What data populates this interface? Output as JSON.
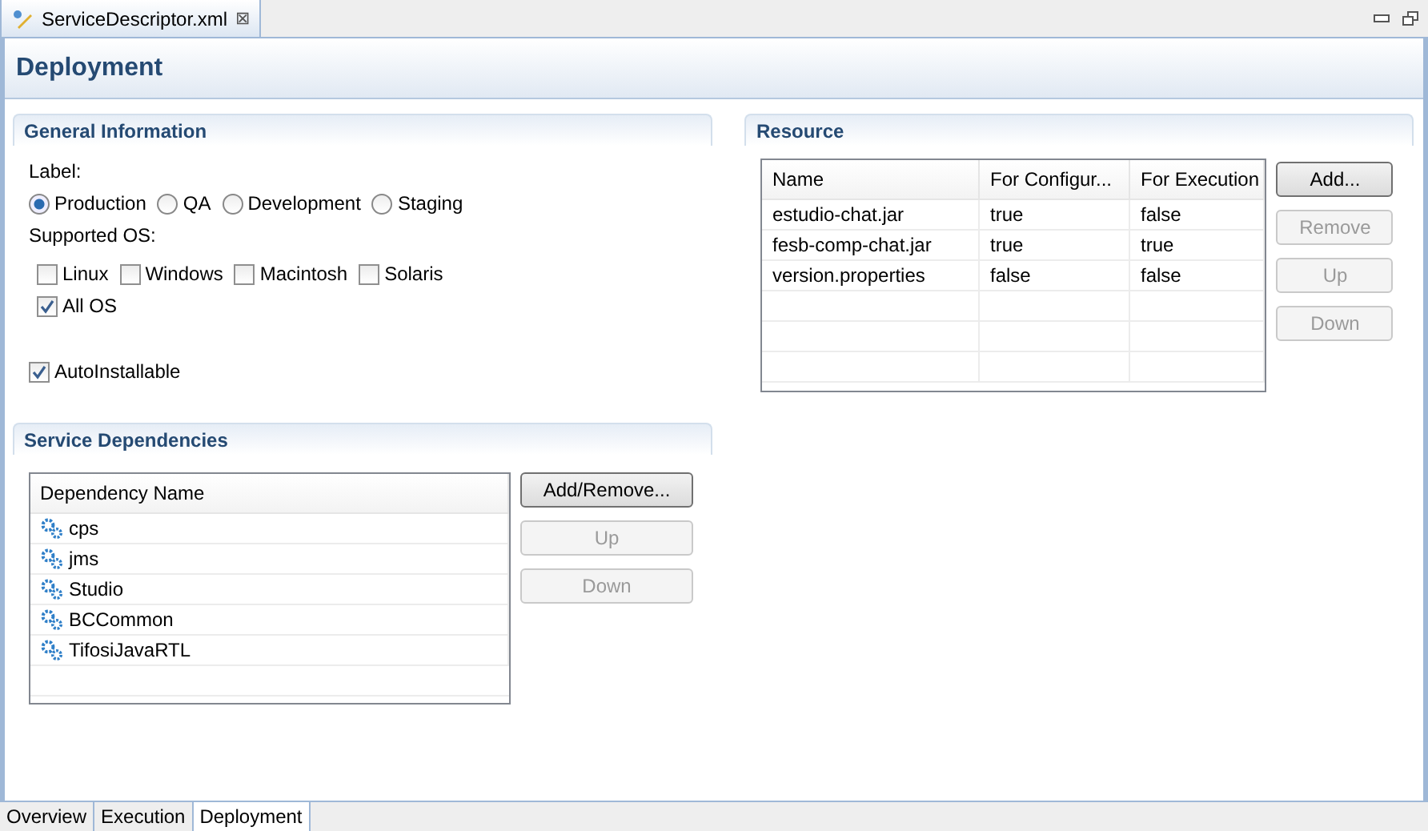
{
  "editor_tab": {
    "title": "ServiceDescriptor.xml",
    "close": "⊠"
  },
  "page_title": "Deployment",
  "general_information": {
    "title": "General Information",
    "label_caption": "Label:",
    "labels": [
      {
        "text": "Production",
        "selected": true
      },
      {
        "text": "QA",
        "selected": false
      },
      {
        "text": "Development",
        "selected": false
      },
      {
        "text": "Staging",
        "selected": false
      }
    ],
    "os_caption": "Supported OS:",
    "os": [
      {
        "text": "Linux",
        "checked": false
      },
      {
        "text": "Windows",
        "checked": false
      },
      {
        "text": "Macintosh",
        "checked": false
      },
      {
        "text": "Solaris",
        "checked": false
      }
    ],
    "all_os": {
      "text": "All OS",
      "checked": true
    },
    "auto_installable": {
      "text": "AutoInstallable",
      "checked": true
    }
  },
  "service_dependencies": {
    "title": "Service Dependencies",
    "column": "Dependency Name",
    "rows": [
      "cps",
      "jms",
      "Studio",
      "BCCommon",
      "TifosiJavaRTL"
    ],
    "buttons": [
      {
        "label": "Add/Remove...",
        "disabled": false
      },
      {
        "label": "Up",
        "disabled": true
      },
      {
        "label": "Down",
        "disabled": true
      }
    ]
  },
  "resource": {
    "title": "Resource",
    "columns": [
      "Name",
      "For Configur...",
      "For Execution"
    ],
    "rows": [
      [
        "estudio-chat.jar",
        "true",
        "false"
      ],
      [
        "fesb-comp-chat.jar",
        "true",
        "true"
      ],
      [
        "version.properties",
        "false",
        "false"
      ]
    ],
    "buttons": [
      {
        "label": "Add...",
        "disabled": false
      },
      {
        "label": "Remove",
        "disabled": true
      },
      {
        "label": "Up",
        "disabled": true
      },
      {
        "label": "Down",
        "disabled": true
      }
    ]
  },
  "bottom_tabs": [
    {
      "label": "Overview",
      "selected": false
    },
    {
      "label": "Execution",
      "selected": false
    },
    {
      "label": "Deployment",
      "selected": true
    }
  ]
}
